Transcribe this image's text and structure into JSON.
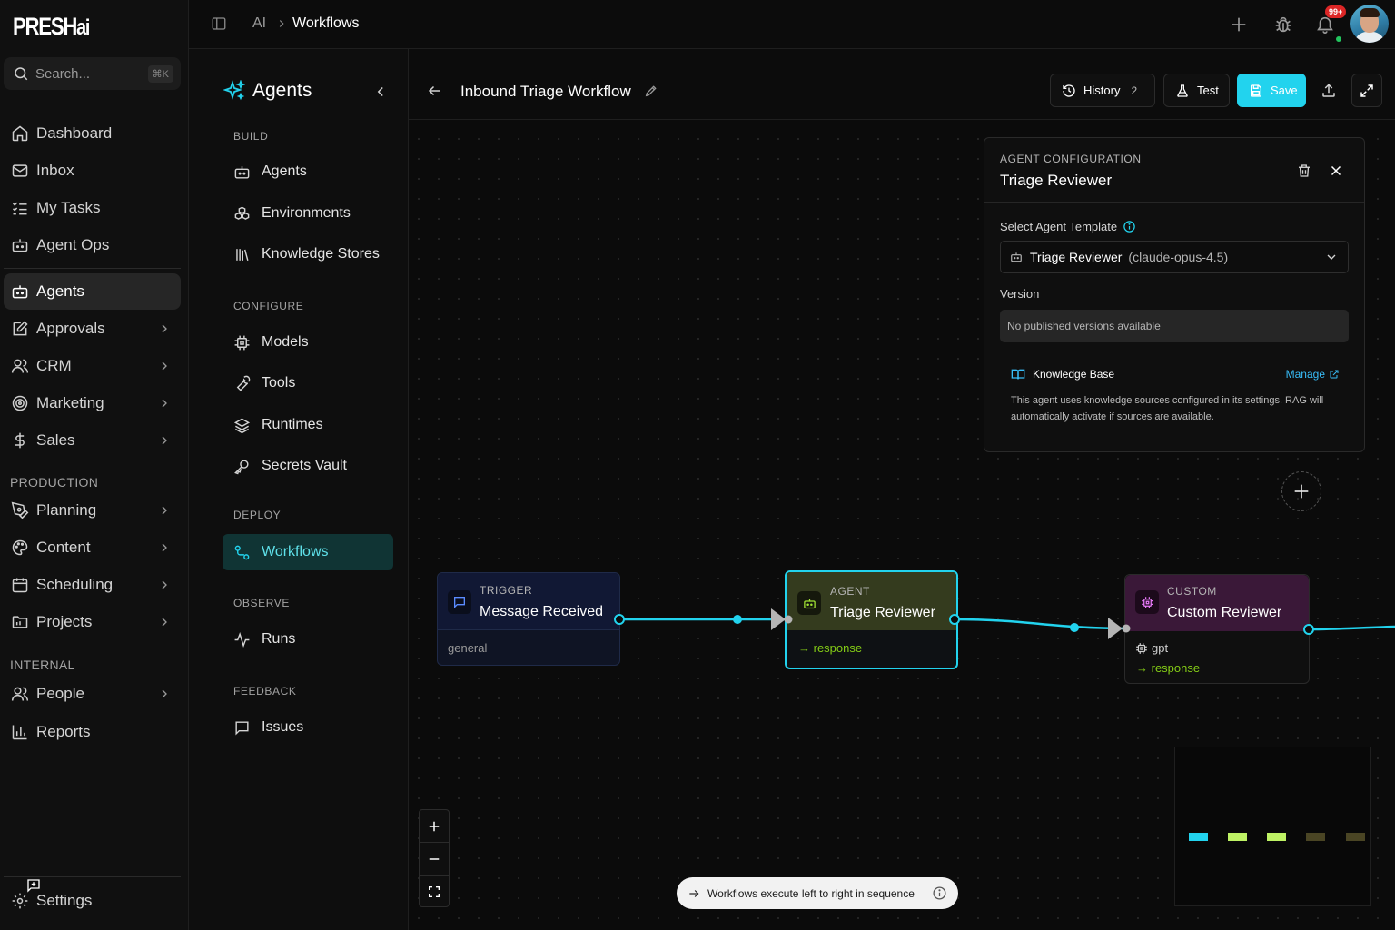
{
  "brand": {
    "logo": "PRESH",
    "logo_suffix": "ai"
  },
  "search": {
    "placeholder": "Search...",
    "shortcut": "⌘K"
  },
  "sidebar": {
    "items": [
      {
        "label": "Dashboard",
        "icon": "home-icon"
      },
      {
        "label": "Inbox",
        "icon": "mail-icon"
      },
      {
        "label": "My Tasks",
        "icon": "list-checks-icon"
      },
      {
        "label": "Agent Ops",
        "icon": "bot-icon"
      },
      {
        "label": "Agents",
        "icon": "bot-icon",
        "active": true
      },
      {
        "label": "Approvals",
        "icon": "edit-square-icon"
      },
      {
        "label": "CRM",
        "icon": "users-icon"
      },
      {
        "label": "Marketing",
        "icon": "target-icon"
      },
      {
        "label": "Sales",
        "icon": "dollar-icon"
      }
    ],
    "production_label": "PRODUCTION",
    "production_items": [
      {
        "label": "Planning",
        "icon": "pen-tool-icon"
      },
      {
        "label": "Content",
        "icon": "palette-icon"
      },
      {
        "label": "Scheduling",
        "icon": "calendar-icon"
      },
      {
        "label": "Projects",
        "icon": "folder-icon"
      }
    ],
    "internal_label": "INTERNAL",
    "internal_items": [
      {
        "label": "People",
        "icon": "people-icon"
      },
      {
        "label": "Reports",
        "icon": "bar-chart-icon"
      }
    ],
    "settings_label": "Settings"
  },
  "topbar": {
    "crumb_root": "AI",
    "crumb_current": "Workflows",
    "notif_count": "99+"
  },
  "subnav": {
    "title": "Agents",
    "build_label": "BUILD",
    "build_items": [
      "Agents",
      "Environments",
      "Knowledge Stores"
    ],
    "configure_label": "CONFIGURE",
    "configure_items": [
      "Models",
      "Tools",
      "Runtimes",
      "Secrets Vault"
    ],
    "deploy_label": "DEPLOY",
    "deploy_items": [
      "Workflows"
    ],
    "observe_label": "OBSERVE",
    "observe_items": [
      "Runs"
    ],
    "feedback_label": "FEEDBACK",
    "feedback_items": [
      "Issues"
    ]
  },
  "workflow": {
    "title": "Inbound Triage Workflow",
    "history_label": "History",
    "history_count": "2",
    "test_label": "Test",
    "save_label": "Save"
  },
  "config": {
    "eyebrow": "AGENT CONFIGURATION",
    "title": "Triage Reviewer",
    "template_label": "Select Agent Template",
    "template_name": "Triage Reviewer",
    "template_model": "(claude-opus-4.5)",
    "version_label": "Version",
    "version_value": "No published versions available",
    "kb_title": "Knowledge Base",
    "kb_manage": "Manage",
    "kb_desc": "This agent uses knowledge sources configured in its settings. RAG will automatically activate if sources are available."
  },
  "nodes": {
    "trigger": {
      "eyebrow": "TRIGGER",
      "title": "Message Received",
      "foot": "general"
    },
    "agent": {
      "eyebrow": "AGENT",
      "title": "Triage Reviewer",
      "foot": "→ response"
    },
    "custom": {
      "eyebrow": "CUSTOM",
      "title": "Custom Reviewer",
      "model": "gpt",
      "foot": "→ response"
    }
  },
  "hint": "Workflows execute left to right in sequence",
  "colors": {
    "accent": "#22d3ee",
    "trigger_head": "#111834",
    "agent_head": "#343b1e",
    "custom_head": "#3a1838",
    "response_green": "#84cc16",
    "minimap": [
      "#22d3ee",
      "#bef264",
      "#bef264",
      "#4a4524",
      "#4a4524"
    ]
  }
}
